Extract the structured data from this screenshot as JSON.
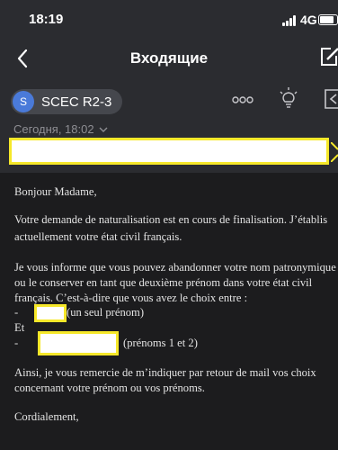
{
  "status_bar": {
    "time": "18:19",
    "network": "4G",
    "battery_level": 0.9
  },
  "nav": {
    "title": "Входящие"
  },
  "email": {
    "sender_initial": "S",
    "sender_name": "SCEC R2-3",
    "date": "Сегодня, 18:02",
    "body": {
      "greeting": "Bonjour Madame,",
      "p1_line1": "Votre demande de naturalisation est en cours de finalisation. J’établis",
      "p1_line2": "actuellement votre état civil français.",
      "p2_line1": "Je vous informe que vous pouvez abandonner votre nom patronymique",
      "p2_line2": "ou le conserver en tant que deuxième prénom dans votre état civil",
      "p2_line3": "français. C’est-à-dire que vous avez le choix entre :",
      "dash": "-",
      "option1_note": "(un seul prénom)",
      "et": "Et",
      "option2_note": "(prénoms 1 et 2)",
      "p3_line1": "Ainsi, je vous remercie de m’indiquer par retour de mail vos choix",
      "p3_line2": "concernant votre prénom ou vos prénoms.",
      "closing": "Cordialement,"
    }
  },
  "colors": {
    "header_bg": "#2b2c30",
    "body_bg": "#1c1c1e",
    "highlight": "#f6e82a",
    "avatar": "#4a7ad9"
  },
  "icons": [
    "back-chevron-icon",
    "compose-icon",
    "more-icon",
    "bulb-icon",
    "forward-icon",
    "chevron-down-icon"
  ]
}
